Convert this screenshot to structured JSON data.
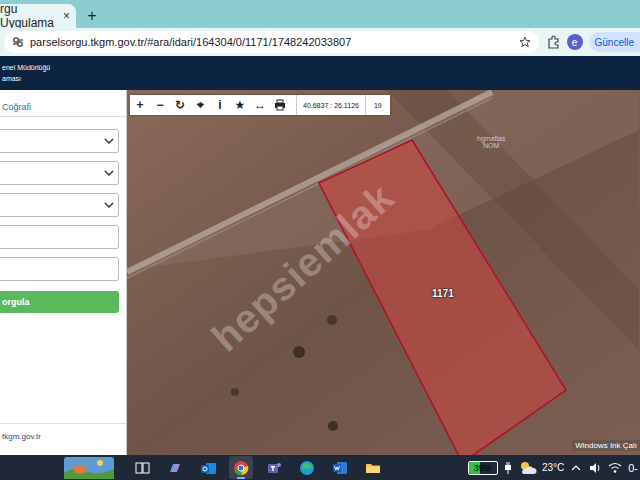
{
  "browser": {
    "tab": {
      "title": "rgu Uygulama",
      "close": "×"
    },
    "new_tab": "+",
    "url": "parselsorgu.tkgm.gov.tr/#ara/idari/164304/0/1171/1748242033807",
    "profile": "e",
    "update_button": "Güncelle"
  },
  "header": {
    "line1": "enel Müdürlüğü",
    "line2": "aması"
  },
  "sidebar": {
    "tab": "Coğrafi",
    "fields": [
      {
        "kind": "select"
      },
      {
        "kind": "select"
      },
      {
        "kind": "select"
      },
      {
        "kind": "input"
      },
      {
        "kind": "input"
      }
    ],
    "query_button": "orgula",
    "footer": "tkgm.gov.tr"
  },
  "map": {
    "toolbar": [
      "+",
      "−",
      "↻",
      "⌖",
      "i",
      "★",
      "↔"
    ],
    "coordinates": "40.6837 : 26.1126",
    "zoom": "19",
    "parcel_label": "1171",
    "basemap_label": [
      "hgmatlas",
      "NOM"
    ],
    "watermark": "hepsiemlak",
    "ink_notice": "Windows Ink Çalı"
  },
  "taskbar": {
    "apps": [
      {
        "active": false
      },
      {
        "active": false
      },
      {
        "active": false
      },
      {
        "active": true
      },
      {
        "active": false
      },
      {
        "active": false
      },
      {
        "active": false
      },
      {
        "active": false
      }
    ],
    "battery": {
      "level": 0.39,
      "reading": "39%"
    },
    "weather": "23°C",
    "clock": "0-"
  }
}
